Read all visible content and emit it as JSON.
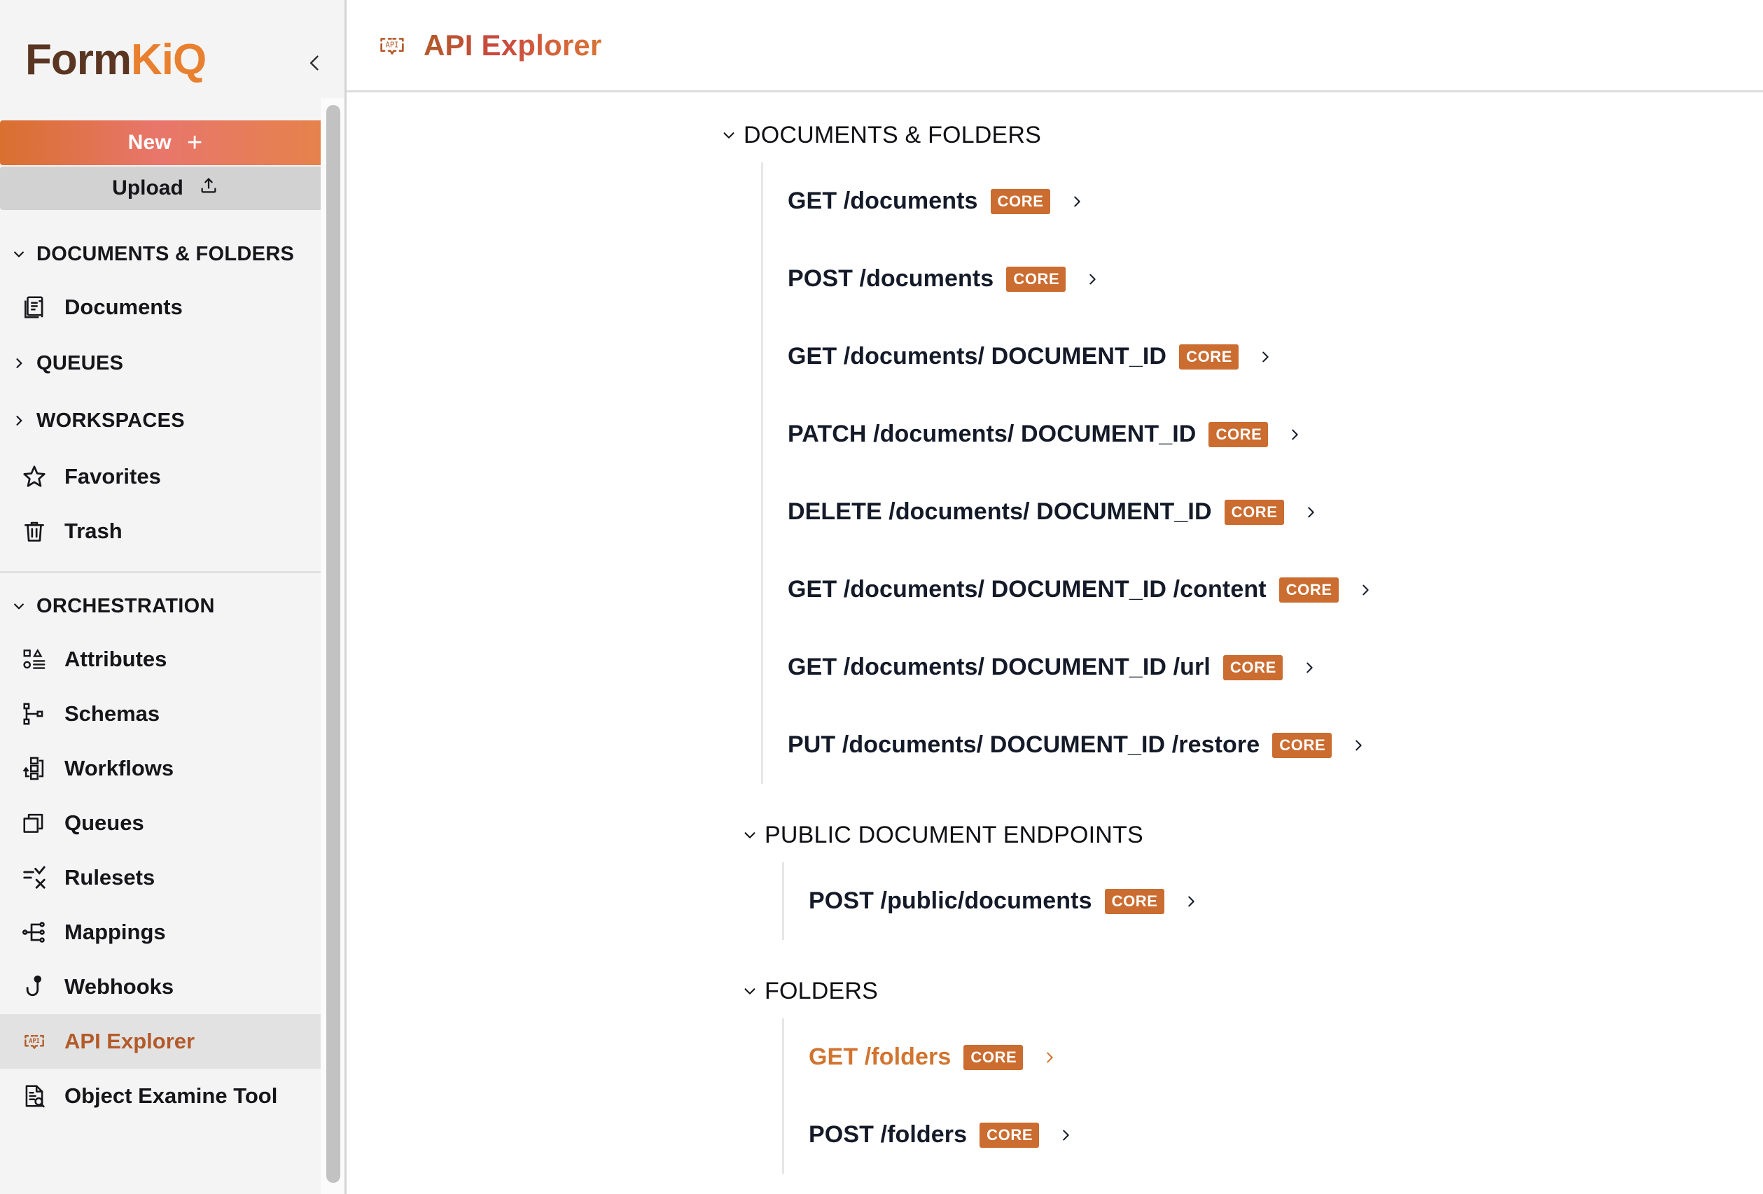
{
  "sidebar": {
    "logo": {
      "part1": "Form",
      "part2": "KiQ"
    },
    "collapse_icon": "chevron-left-icon",
    "new_button": {
      "label": "New",
      "icon": "plus-icon"
    },
    "upload_button": {
      "label": "Upload",
      "icon": "upload-icon"
    },
    "groups": [
      {
        "header": "DOCUMENTS & FOLDERS",
        "expanded": true,
        "chevron": "chevron-down-icon",
        "items": [
          {
            "label": "Documents",
            "icon": "documents-icon",
            "kind": "item",
            "active": false
          }
        ]
      },
      {
        "header": "QUEUES",
        "expanded": false,
        "chevron": "chevron-right-icon",
        "items": []
      },
      {
        "header": "WORKSPACES",
        "expanded": false,
        "chevron": "chevron-right-icon",
        "items": []
      }
    ],
    "standalone_items": [
      {
        "label": "Favorites",
        "icon": "star-icon",
        "active": false
      },
      {
        "label": "Trash",
        "icon": "trash-icon",
        "active": false
      }
    ],
    "orchestration": {
      "header": "ORCHESTRATION",
      "expanded": true,
      "chevron": "chevron-down-icon",
      "items": [
        {
          "label": "Attributes",
          "icon": "attributes-icon",
          "active": false
        },
        {
          "label": "Schemas",
          "icon": "schemas-icon",
          "active": false
        },
        {
          "label": "Workflows",
          "icon": "workflows-icon",
          "active": false
        },
        {
          "label": "Queues",
          "icon": "queues-stack-icon",
          "active": false
        },
        {
          "label": "Rulesets",
          "icon": "rulesets-icon",
          "active": false
        },
        {
          "label": "Mappings",
          "icon": "mappings-icon",
          "active": false
        },
        {
          "label": "Webhooks",
          "icon": "webhook-icon",
          "active": false
        },
        {
          "label": "API Explorer",
          "icon": "api-icon",
          "active": true
        },
        {
          "label": "Object Examine Tool",
          "icon": "object-examine-icon",
          "active": false
        }
      ]
    },
    "scrollbar": {
      "name": "sidebar-scrollbar"
    }
  },
  "header": {
    "icon": "api-icon",
    "title": "API Explorer"
  },
  "colors": {
    "brand_orange": "#e8802f",
    "badge_orange": "#cb6c30",
    "active_text": "#d2742f",
    "sidebar_bg": "#f4f4f4",
    "active_item_bg": "#e2e2e2",
    "endpoint_text": "#141a28"
  },
  "main": {
    "sections": [
      {
        "title": "DOCUMENTS & FOLDERS",
        "expanded": true,
        "chevron": "chevron-down-icon",
        "indent": "normal",
        "endpoints": [
          {
            "label": "GET /documents",
            "badge": "CORE",
            "chevron": "chevron-right-icon",
            "active": false
          },
          {
            "label": "POST /documents",
            "badge": "CORE",
            "chevron": "chevron-right-icon",
            "active": false
          },
          {
            "label": "GET /documents/ DOCUMENT_ID",
            "badge": "CORE",
            "chevron": "chevron-right-icon",
            "active": false
          },
          {
            "label": "PATCH /documents/ DOCUMENT_ID",
            "badge": "CORE",
            "chevron": "chevron-right-icon",
            "active": false
          },
          {
            "label": "DELETE /documents/ DOCUMENT_ID",
            "badge": "CORE",
            "chevron": "chevron-right-icon",
            "active": false
          },
          {
            "label": "GET /documents/ DOCUMENT_ID /content",
            "badge": "CORE",
            "chevron": "chevron-right-icon",
            "active": false
          },
          {
            "label": "GET /documents/ DOCUMENT_ID /url",
            "badge": "CORE",
            "chevron": "chevron-right-icon",
            "active": false
          },
          {
            "label": "PUT /documents/ DOCUMENT_ID /restore",
            "badge": "CORE",
            "chevron": "chevron-right-icon",
            "active": false
          }
        ]
      },
      {
        "title": "PUBLIC DOCUMENT ENDPOINTS",
        "expanded": true,
        "chevron": "chevron-down-icon",
        "indent": "deep",
        "endpoints": [
          {
            "label": "POST /public/documents",
            "badge": "CORE",
            "chevron": "chevron-right-icon",
            "active": false
          }
        ]
      },
      {
        "title": "FOLDERS",
        "expanded": true,
        "chevron": "chevron-down-icon",
        "indent": "deep",
        "endpoints": [
          {
            "label": "GET /folders",
            "badge": "CORE",
            "chevron": "chevron-right-icon",
            "active": true
          },
          {
            "label": "POST /folders",
            "badge": "CORE",
            "chevron": "chevron-right-icon",
            "active": false
          }
        ]
      }
    ]
  }
}
